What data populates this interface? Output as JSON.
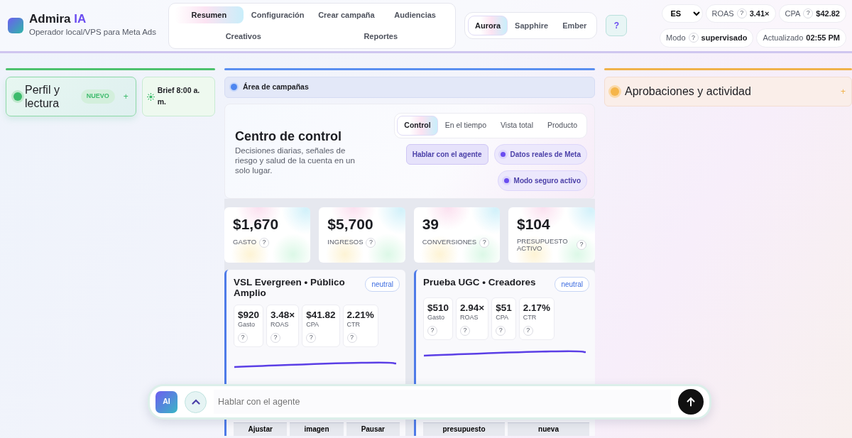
{
  "brand": {
    "name": "Admira",
    "accent": "IA",
    "subtitle": "Operador local/VPS para Meta Ads"
  },
  "nav": [
    {
      "label": "Resumen",
      "selected": true
    },
    {
      "label": "Configuración",
      "selected": false
    },
    {
      "label": "Crear campaña",
      "selected": false
    },
    {
      "label": "Audiencias",
      "selected": false
    },
    {
      "label": "Creativos",
      "selected": false
    },
    {
      "label": "Reportes",
      "selected": false
    }
  ],
  "themes": [
    {
      "label": "Aurora",
      "selected": true
    },
    {
      "label": "Sapphire",
      "selected": false
    },
    {
      "label": "Ember",
      "selected": false
    }
  ],
  "help_button": "?",
  "language": "ES",
  "header_stats": [
    {
      "label": "ROAS",
      "help": "?",
      "value": "3.41×"
    },
    {
      "label": "CPA",
      "help": "?",
      "value": "$42.82"
    },
    {
      "label": "Modo",
      "help": "?",
      "value": "supervisado"
    },
    {
      "label": "Actualizado",
      "value": "02:55 PM"
    }
  ],
  "left_panel": {
    "title": "Perfil y lectura",
    "badge": "NUEVO",
    "plus": "+",
    "brief": "Brief 8:00 a. m."
  },
  "area_label": "Área de campañas",
  "control": {
    "title": "Centro de control",
    "description": "Decisiones diarias, señales de riesgo y salud de la cuenta en un solo lugar.",
    "tabs": [
      {
        "label": "Control",
        "selected": true
      },
      {
        "label": "En el tiempo",
        "selected": false
      },
      {
        "label": "Vista total",
        "selected": false
      },
      {
        "label": "Producto",
        "selected": false
      }
    ],
    "actions": [
      {
        "label": "Hablar con el agente",
        "kind": "button"
      },
      {
        "label": "Datos reales de Meta",
        "kind": "status"
      },
      {
        "label": "Modo seguro activo",
        "kind": "status"
      }
    ]
  },
  "kpis": [
    {
      "value": "$1,670",
      "label": "GASTO",
      "help": "?"
    },
    {
      "value": "$5,700",
      "label": "INGRESOS",
      "help": "?"
    },
    {
      "value": "39",
      "label": "CONVERSIONES",
      "help": "?"
    },
    {
      "value": "$104",
      "label": "PRESUPUESTO ACTIVO",
      "help": "?"
    }
  ],
  "campaigns": [
    {
      "title": "VSL Evergreen • Público Amplio",
      "badge": "neutral",
      "metrics": [
        {
          "value": "$920",
          "label": "Gasto",
          "help": "?"
        },
        {
          "value": "3.48×",
          "label": "ROAS",
          "help": "?"
        },
        {
          "value": "$41.82",
          "label": "CPA",
          "help": "?"
        },
        {
          "value": "2.21%",
          "label": "CTR",
          "help": "?"
        }
      ],
      "actions": [
        "Ajustar",
        "imagen",
        "Pausar"
      ]
    },
    {
      "title": "Prueba UGC • Creadores",
      "badge": "neutral",
      "metrics": [
        {
          "value": "$510",
          "label": "Gasto",
          "help": "?"
        },
        {
          "value": "2.94×",
          "label": "ROAS",
          "help": "?"
        },
        {
          "value": "$51",
          "label": "CPA",
          "help": "?"
        },
        {
          "value": "2.17%",
          "label": "CTR",
          "help": "?"
        }
      ],
      "actions": [
        "presupuesto",
        "nueva"
      ]
    }
  ],
  "right_panel": {
    "title": "Aprobaciones y actividad",
    "plus": "+"
  },
  "chat": {
    "avatar": "AI",
    "placeholder": "Hablar con el agente"
  }
}
